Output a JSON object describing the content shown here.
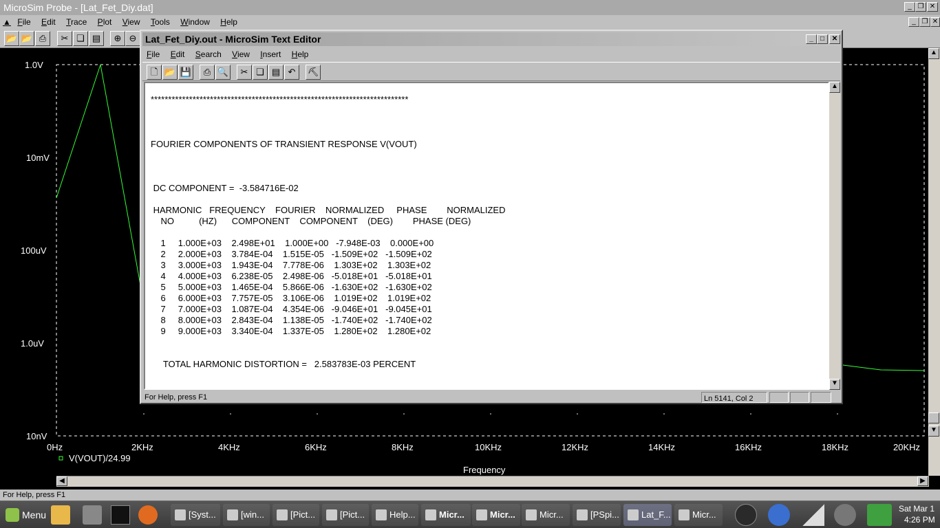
{
  "probe": {
    "title": "MicroSim Probe - [Lat_Fet_Diy.dat]",
    "menu": [
      "File",
      "Edit",
      "Trace",
      "Plot",
      "View",
      "Tools",
      "Window",
      "Help"
    ],
    "status": "For Help, press F1",
    "y_ticks": [
      "1.0V",
      "10mV",
      "100uV",
      "1.0uV",
      "10nV"
    ],
    "x_ticks": [
      "0Hz",
      "2KHz",
      "4KHz",
      "6KHz",
      "8KHz",
      "10KHz",
      "12KHz",
      "14KHz",
      "16KHz",
      "18KHz",
      "20KHz"
    ],
    "x_label": "Frequency",
    "trace_label": "V(VOUT)/24.99",
    "trace_color": "#33ff33"
  },
  "editor": {
    "title": "Lat_Fet_Diy.out - MicroSim Text Editor",
    "menu": [
      "File",
      "Edit",
      "Search",
      "View",
      "Insert",
      "Help"
    ],
    "status": "For Help, press F1",
    "position": "Ln 5141, Col 2",
    "lines": {
      "stars": "**************************************************************************",
      "heading": "FOURIER COMPONENTS OF TRANSIENT RESPONSE V(VOUT)",
      "dc": " DC COMPONENT =  -3.584716E-02",
      "hdr1": " HARMONIC   FREQUENCY    FOURIER    NORMALIZED     PHASE        NORMALIZED",
      "hdr2": "    NO          (HZ)      COMPONENT    COMPONENT    (DEG)        PHASE (DEG)",
      "rows": [
        "    1     1.000E+03    2.498E+01    1.000E+00   -7.948E-03    0.000E+00",
        "    2     2.000E+03    3.784E-04    1.515E-05   -1.509E+02   -1.509E+02",
        "    3     3.000E+03    1.943E-04    7.778E-06    1.303E+02    1.303E+02",
        "    4     4.000E+03    6.238E-05    2.498E-06   -5.018E+01   -5.018E+01",
        "    5     5.000E+03    1.465E-04    5.866E-06   -1.630E+02   -1.630E+02",
        "    6     6.000E+03    7.757E-05    3.106E-06    1.019E+02    1.019E+02",
        "    7     7.000E+03    1.087E-04    4.354E-06   -9.046E+01   -9.045E+01",
        "    8     8.000E+03    2.843E-04    1.138E-05   -1.740E+02   -1.740E+02",
        "    9     9.000E+03    3.340E-04    1.337E-05    1.280E+02    1.280E+02"
      ],
      "thd": "     TOTAL HARMONIC DISTORTION =   2.583783E-03 PERCENT"
    }
  },
  "taskbar": {
    "menu_label": "Menu",
    "tasks": [
      "[Syst...",
      "[win...",
      "[Pict...",
      "[Pict...",
      "Help...",
      "Micr...",
      "Micr...",
      "Micr...",
      "[PSpi...",
      "Lat_F...",
      "Micr..."
    ],
    "clock_date": "Sat Mar 1",
    "clock_time": "4:26 PM"
  }
}
